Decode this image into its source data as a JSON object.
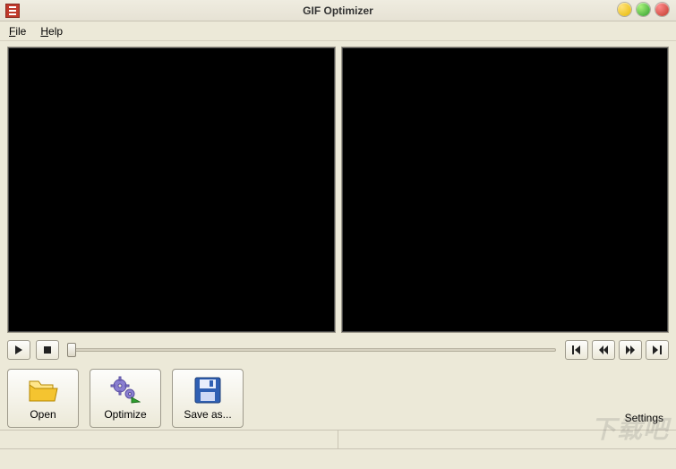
{
  "window": {
    "title": "GIF Optimizer"
  },
  "menu": {
    "file": "File",
    "help": "Help"
  },
  "playback": {
    "play_tip": "Play",
    "stop_tip": "Stop",
    "first_tip": "First frame",
    "prev_tip": "Previous frame",
    "next_tip": "Next frame",
    "last_tip": "Last frame"
  },
  "toolbar": {
    "open_label": "Open",
    "optimize_label": "Optimize",
    "saveas_label": "Save as...",
    "settings_label": "Settings"
  },
  "status": {
    "left": "",
    "right": ""
  },
  "watermark": "下载吧"
}
